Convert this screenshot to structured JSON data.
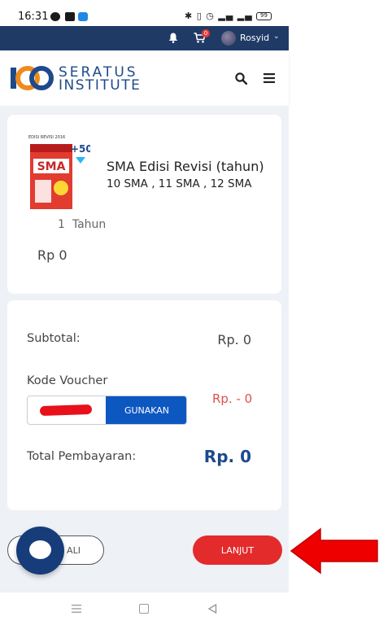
{
  "status_bar": {
    "time": "16:31",
    "battery": "99"
  },
  "top_bar": {
    "cart_count": "0",
    "username": "Rosyid"
  },
  "header": {
    "logo_line1": "SERATUS",
    "logo_line2": "INSTITUTE"
  },
  "product": {
    "title": "SMA Edisi Revisi (tahun)",
    "classes": "10 SMA , 11 SMA , 12 SMA",
    "quantity": "1",
    "duration": "Tahun",
    "price": "Rp 0",
    "book_cover": {
      "top_text": "EDISI REVISI 2016",
      "plus_badge": "+50",
      "brand": "SMA"
    }
  },
  "summary": {
    "subtotal_label": "Subtotal:",
    "subtotal_value": "Rp. 0",
    "voucher_label": "Kode Voucher",
    "voucher_value": "",
    "apply_button": "GUNAKAN",
    "discount_value": "Rp. - 0",
    "total_label": "Total Pembayaran:",
    "total_value": "Rp. 0"
  },
  "actions": {
    "back_label": "ALI",
    "next_label": "LANJUT"
  },
  "colors": {
    "brand_navy": "#203a66",
    "primary_blue": "#0d57c1",
    "accent_red": "#e32b2b",
    "total_blue": "#1e4a8c"
  }
}
